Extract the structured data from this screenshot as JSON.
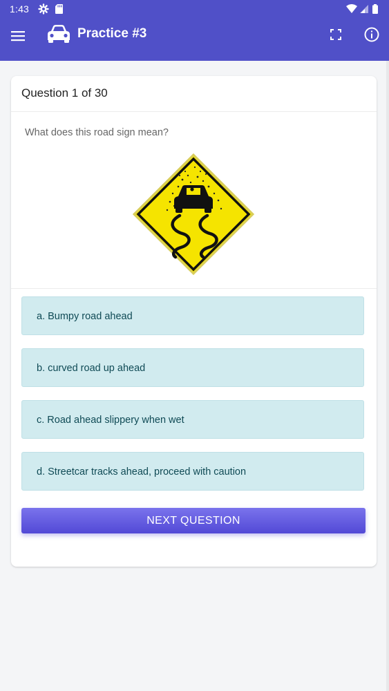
{
  "status_bar": {
    "time": "1:43",
    "icons": [
      "gear-icon",
      "sd-card-icon",
      "wifi-icon",
      "signal-icon",
      "battery-icon"
    ]
  },
  "app_bar": {
    "title": "Practice #3",
    "icons": [
      "menu-icon",
      "car-icon",
      "fullscreen-icon",
      "info-icon"
    ],
    "color": "#5050c8"
  },
  "quiz": {
    "question_count": "Question 1 of 30",
    "prompt": "What does this road sign meaning?",
    "sign_icon": "slippery-road-sign-icon",
    "answers": [
      {
        "label": "a. Bumpy road ahead"
      },
      {
        "label": "b. curved road up ahead"
      },
      {
        "label": "c. Road ahead slippery when wet"
      },
      {
        "label": "d. Streetcar tracks ahead, proceed with caution"
      }
    ],
    "next_button_label": "NEXT QUESTION",
    "answer_bg_color": "#d1ebef",
    "button_color": "#5249d6"
  }
}
